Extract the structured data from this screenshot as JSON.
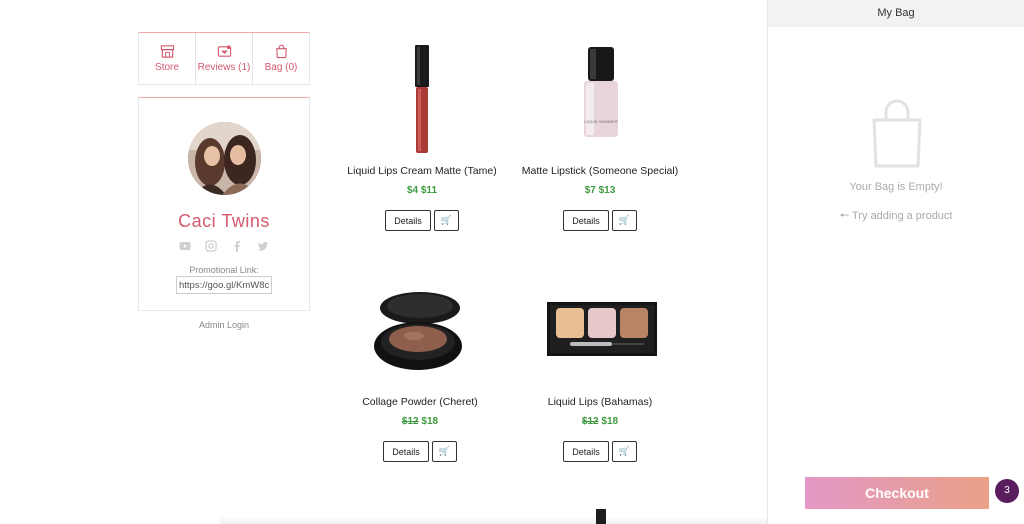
{
  "nav": {
    "store": "Store",
    "reviews": "Reviews (1)",
    "bag": "Bag (0)"
  },
  "profile": {
    "name": "Caci Twins",
    "promo_label": "Promotional Link:",
    "promo_value": "https://goo.gl/KmW8c",
    "admin_login": "Admin Login",
    "social_icons": [
      "youtube-icon",
      "instagram-icon",
      "facebook-icon",
      "twitter-icon"
    ]
  },
  "products": [
    {
      "name": "Liquid Lips Cream Matte (Tame)",
      "old_price": "",
      "price": "$4 $11",
      "details_label": "Details"
    },
    {
      "name": "Matte Lipstick (Someone Special)",
      "old_price": "",
      "price": "$7 $13",
      "details_label": "Details"
    },
    {
      "name": "Collage Powder (Cheret)",
      "old_price": "$12",
      "price": "$18",
      "details_label": "Details"
    },
    {
      "name": "Liquid Lips (Bahamas)",
      "old_price": "$12",
      "price": "$18",
      "details_label": "Details"
    }
  ],
  "bag": {
    "title": "My Bag",
    "empty_text": "Your Bag is Empty!",
    "try_text": "Try adding a product",
    "checkout_label": "Checkout",
    "badge_count": "3"
  },
  "colors": {
    "accent": "#d45a6e",
    "price_green": "#3f9a3f",
    "checkout_start": "#e398c6",
    "checkout_end": "#eaa187",
    "badge": "#5a1e5e"
  }
}
